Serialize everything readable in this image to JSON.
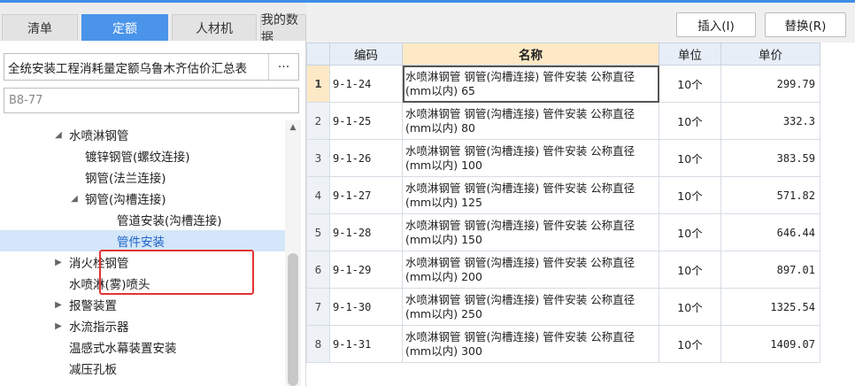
{
  "tabs": [
    {
      "label": "清单",
      "active": false
    },
    {
      "label": "定额",
      "active": true
    },
    {
      "label": "人材机",
      "active": false
    },
    {
      "label": "我的数据",
      "active": false
    }
  ],
  "selector": {
    "value": "全统安装工程消耗量定额乌鲁木齐估价汇总表",
    "button_label": "···"
  },
  "search": {
    "value": "",
    "placeholder": "B8-77"
  },
  "tree": [
    {
      "label": "水喷淋钢管",
      "arrow": "◢"
    },
    {
      "label": "镀锌钢管(螺纹连接)",
      "arrow": ""
    },
    {
      "label": "钢管(法兰连接)",
      "arrow": ""
    },
    {
      "label": "钢管(沟槽连接)",
      "arrow": "◢"
    },
    {
      "label": "管道安装(沟槽连接)",
      "arrow": ""
    },
    {
      "label": "管件安装",
      "arrow": "",
      "selected": true
    },
    {
      "label": "消火栓钢管",
      "arrow": "▶"
    },
    {
      "label": "水喷淋(雾)喷头",
      "arrow": ""
    },
    {
      "label": "报警装置",
      "arrow": "▶"
    },
    {
      "label": "水流指示器",
      "arrow": "▶"
    },
    {
      "label": "温感式水幕装置安装",
      "arrow": ""
    },
    {
      "label": "减压孔板",
      "arrow": ""
    }
  ],
  "toolbar": {
    "insert_label": "插入(I)",
    "replace_label": "替换(R)"
  },
  "grid": {
    "headers": {
      "code": "编码",
      "name": "名称",
      "unit": "单位",
      "price": "单价"
    },
    "rows": [
      {
        "index": "1",
        "code": "9-1-24",
        "name": "水喷淋钢管 钢管(沟槽连接) 管件安装 公称直径(mm以内) 65",
        "unit": "10个",
        "price": "299.79"
      },
      {
        "index": "2",
        "code": "9-1-25",
        "name": "水喷淋钢管 钢管(沟槽连接) 管件安装 公称直径(mm以内) 80",
        "unit": "10个",
        "price": "332.3"
      },
      {
        "index": "3",
        "code": "9-1-26",
        "name": "水喷淋钢管 钢管(沟槽连接) 管件安装 公称直径(mm以内) 100",
        "unit": "10个",
        "price": "383.59"
      },
      {
        "index": "4",
        "code": "9-1-27",
        "name": "水喷淋钢管 钢管(沟槽连接) 管件安装 公称直径(mm以内) 125",
        "unit": "10个",
        "price": "571.82"
      },
      {
        "index": "5",
        "code": "9-1-28",
        "name": "水喷淋钢管 钢管(沟槽连接) 管件安装 公称直径(mm以内) 150",
        "unit": "10个",
        "price": "646.44"
      },
      {
        "index": "6",
        "code": "9-1-29",
        "name": "水喷淋钢管 钢管(沟槽连接) 管件安装 公称直径(mm以内) 200",
        "unit": "10个",
        "price": "897.01"
      },
      {
        "index": "7",
        "code": "9-1-30",
        "name": "水喷淋钢管 钢管(沟槽连接) 管件安装 公称直径(mm以内) 250",
        "unit": "10个",
        "price": "1325.54"
      },
      {
        "index": "8",
        "code": "9-1-31",
        "name": "水喷淋钢管 钢管(沟槽连接) 管件安装 公称直径(mm以内) 300",
        "unit": "10个",
        "price": "1409.07"
      }
    ]
  },
  "colors": {
    "accent": "#4a94ea",
    "highlight": "#e53333",
    "selected_bg": "#d3e6fa",
    "header_hl": "#fde9c6"
  }
}
